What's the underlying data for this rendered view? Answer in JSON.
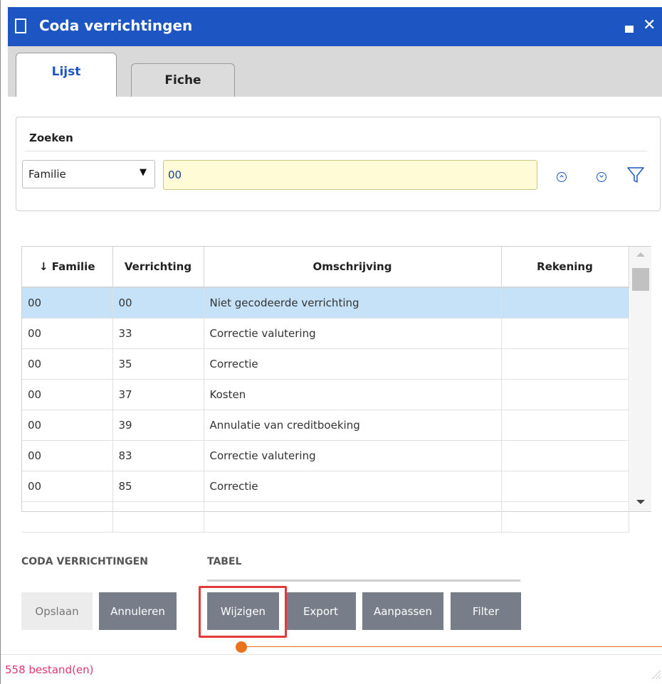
{
  "window": {
    "title": "Coda verrichtingen"
  },
  "tabs": [
    {
      "label": "Lijst",
      "active": true
    },
    {
      "label": "Fiche",
      "active": false
    }
  ],
  "search": {
    "title": "Zoeken",
    "field_selected": "Familie",
    "value": "00"
  },
  "grid": {
    "columns": [
      "↓ Familie",
      "Verrichting",
      "Omschrijving",
      "Rekening"
    ],
    "rows": [
      {
        "familie": "00",
        "verrichting": "00",
        "omschrijving": "Niet gecodeerde verrichting",
        "rekening": "",
        "selected": true
      },
      {
        "familie": "00",
        "verrichting": "33",
        "omschrijving": "Correctie valutering",
        "rekening": ""
      },
      {
        "familie": "00",
        "verrichting": "35",
        "omschrijving": "Correctie",
        "rekening": ""
      },
      {
        "familie": "00",
        "verrichting": "37",
        "omschrijving": "Kosten",
        "rekening": ""
      },
      {
        "familie": "00",
        "verrichting": "39",
        "omschrijving": "Annulatie van creditboeking",
        "rekening": ""
      },
      {
        "familie": "00",
        "verrichting": "83",
        "omschrijving": "Correctie valutering",
        "rekening": ""
      },
      {
        "familie": "00",
        "verrichting": "85",
        "omschrijving": "Correctie",
        "rekening": ""
      }
    ]
  },
  "actions": {
    "group1_label": "CODA VERRICHTINGEN",
    "group2_label": "TABEL",
    "save": "Opslaan",
    "cancel": "Annuleren",
    "edit": "Wijzigen",
    "export": "Export",
    "customize": "Aanpassen",
    "filter": "Filter"
  },
  "status": {
    "count_text": "558 bestand(en)"
  },
  "colors": {
    "titlebar": "#1d56c3",
    "selected_row": "#c5e2f9",
    "highlight": "#e23a3a",
    "accent": "#e8731b",
    "status_text": "#e0376e"
  }
}
